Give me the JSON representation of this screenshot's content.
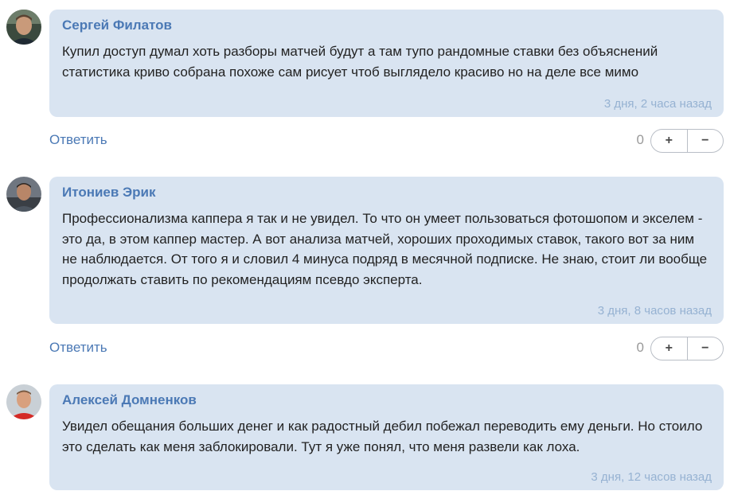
{
  "comments": [
    {
      "author": "Сергей Филатов",
      "text": "Купил доступ думал хоть разборы матчей будут а там тупо рандомные ставки без объяснений статистика криво собрана похоже сам рисует чтоб выглядело красиво но на деле все мимо",
      "time": "3 дня, 2 часа назад",
      "reply_label": "Ответить",
      "score": "0",
      "plus_label": "+",
      "minus_label": "−"
    },
    {
      "author": "Итониев Эрик",
      "text": "Профессионализма каппера я так и не увидел. То что он умеет пользоваться фотошопом и экселем - это да, в этом каппер мастер. А вот анализа матчей, хороших проходимых ставок, такого вот за ним не наблюдается. От того я и словил 4 минуса подряд в месячной подписке. Не знаю, стоит ли вообще продолжать ставить по рекомендациям псевдо эксперта.",
      "time": "3 дня, 8 часов назад",
      "reply_label": "Ответить",
      "score": "0",
      "plus_label": "+",
      "minus_label": "−"
    },
    {
      "author": "Алексей Домненков",
      "text": "Увидел обещания больших денег и как радостный дебил побежал переводить ему деньги. Но стоило это сделать как меня заблокировали. Тут я уже понял, что меня развели как лоха.",
      "time": "3 дня, 12 часов назад"
    }
  ]
}
